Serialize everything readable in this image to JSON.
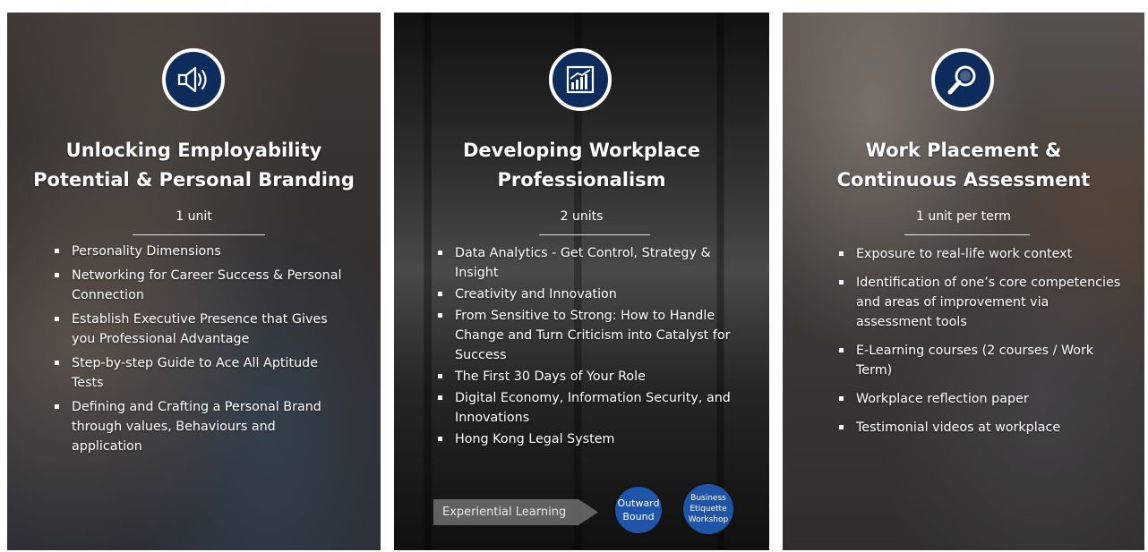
{
  "panels": [
    {
      "title_line1": "Unlocking Employability",
      "title_line2": "Potential & Personal Branding",
      "units": "1 unit",
      "items": [
        "Personality Dimensions",
        "Networking for Career Success & Personal Connection",
        "Establish Executive Presence that Gives you Professional Advantage",
        "Step-by-step Guide to Ace All Aptitude Tests",
        "Defining and Crafting a Personal Brand through values, Behaviours and application"
      ],
      "icon": "megaphone-icon"
    },
    {
      "title_line1": "Developing Workplace",
      "title_line2": "Professionalism",
      "units": "2 units",
      "items": [
        "Data Analytics - Get Control, Strategy & Insight",
        "Creativity and Innovation",
        "From Sensitive to Strong: How to Handle Change and Turn Criticism into Catalyst for Success",
        "The First 30 Days of Your Role",
        "Digital Economy, Information Security, and Innovations",
        "Hong Kong Legal System"
      ],
      "icon": "bar-chart-icon",
      "experiential": "Experiential Learning",
      "outward_line1": "Outward",
      "outward_line2": "Bound",
      "etiquette_line1": "Business",
      "etiquette_line2": "Etiquette",
      "etiquette_line3": "Workshop"
    },
    {
      "title_line1": "Work Placement &",
      "title_line2": "Continuous Assessment",
      "units": "1 unit per term",
      "items": [
        "Exposure to real-life work context",
        "Identification of one’s core competencies and areas of improvement via assessment tools",
        "E-Learning courses (2 courses / Work Term)",
        "Workplace reflection paper",
        "Testimonial videos at workplace"
      ],
      "icon": "magnifier-icon"
    }
  ],
  "colors": {
    "badge": "#0d2c5c",
    "circle": "#1e55a8",
    "arrow": "#6e6e6e"
  }
}
